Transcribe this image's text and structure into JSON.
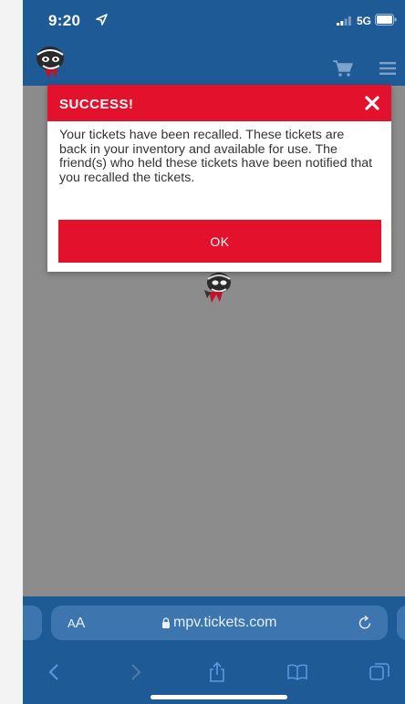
{
  "status_bar": {
    "time": "9:20",
    "network": "5G"
  },
  "header": {
    "logo_icon": "mascot-logo-icon",
    "cart_icon": "cart-icon",
    "menu_icon": "hamburger-menu-icon"
  },
  "modal": {
    "title": "SUCCESS!",
    "message": "Your tickets have been recalled. These tickets are back in your inventory and available for use. The friend(s) who held these tickets have been notified that you recalled the tickets.",
    "ok_label": "OK"
  },
  "browser": {
    "text_size_small": "A",
    "text_size_large": "A",
    "url": "mpv.tickets.com"
  },
  "colors": {
    "brand_blue": "#1d5a96",
    "alert_red": "#e3112b",
    "overlay_gray": "#8c8c8c"
  }
}
